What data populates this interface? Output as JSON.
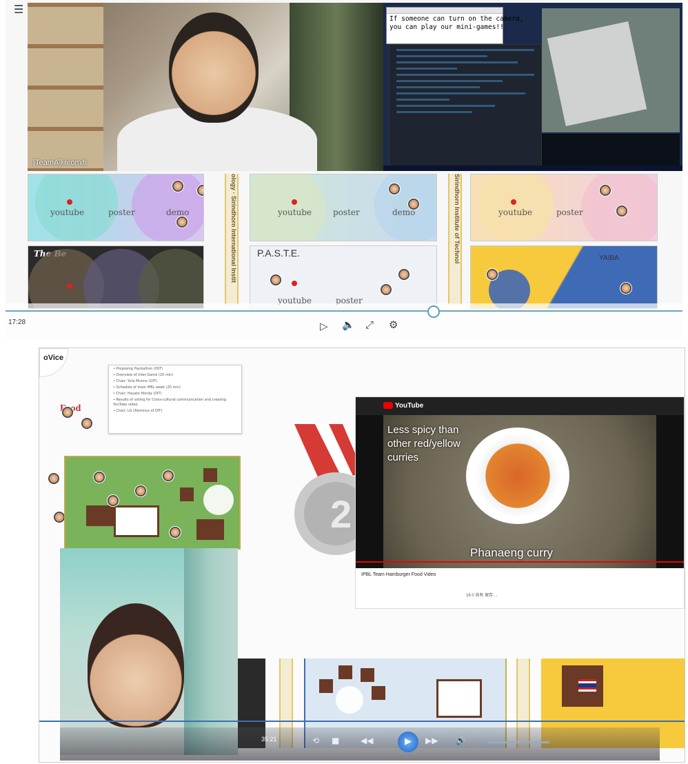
{
  "top": {
    "menu_icon": "hamburger-icon",
    "participant_name": "[TeamA]Hiromiti",
    "notepad_text": "If someone can turn on the camera,\nyou can play our mini-games!!",
    "rooms_row1": [
      {
        "labels": [
          "youtube",
          "poster",
          "demo"
        ]
      },
      {
        "labels": [
          "youtube",
          "poster",
          "demo"
        ]
      },
      {
        "labels": [
          "youtube",
          "poster"
        ]
      }
    ],
    "rooms_row2": [
      {
        "title": "The Be",
        "labels": []
      },
      {
        "title": "P.A.S.T.E.",
        "labels": [
          "youtube",
          "poster"
        ]
      },
      {
        "title": "YAIBA",
        "labels": []
      }
    ],
    "strip_text_1": "ology · Sirindhorn International Instit",
    "strip_text_2": "Sirindhorn Institute of Technol",
    "player": {
      "time": "17:28",
      "icons": [
        "play-icon",
        "volume-icon",
        "fullscreen-icon",
        "settings-icon"
      ]
    }
  },
  "bottom": {
    "app_logo": "oVice",
    "youtube": {
      "brand": "YouTube",
      "caption": "Less spicy than other red/yellow curries",
      "subtitle": "Phanaeng curry",
      "title": "IPBL Team Hamburger Food Video",
      "meta": "16  0  共有  保存  ..."
    },
    "player": {
      "time": "35:21",
      "icons": [
        "loop-icon",
        "stop-icon",
        "rewind-icon",
        "play-icon",
        "fast-forward-icon",
        "volume-icon"
      ]
    },
    "colors": {
      "accent": "#1e5fb8",
      "youtube_red": "#e00000",
      "garden": "#7ab35a"
    }
  }
}
